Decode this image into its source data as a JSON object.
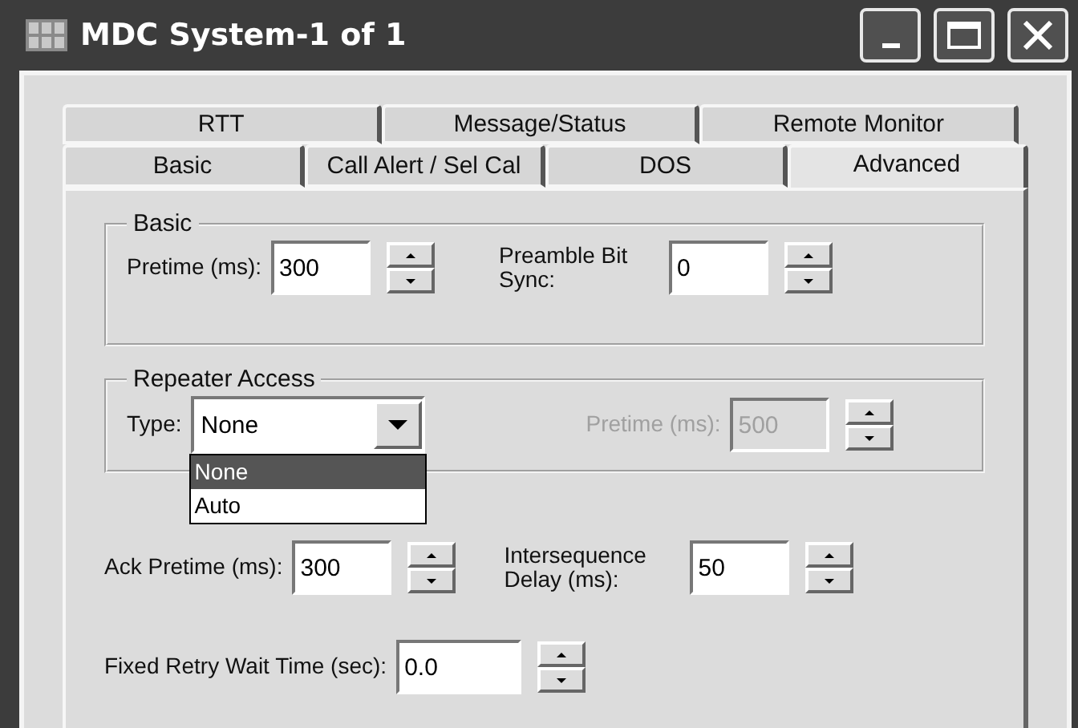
{
  "window": {
    "title": "MDC System-1 of 1"
  },
  "tab_rows": [
    [
      {
        "label": "RTT",
        "selected": false
      },
      {
        "label": "Message/Status",
        "selected": false
      },
      {
        "label": "Remote Monitor",
        "selected": false
      }
    ],
    [
      {
        "label": "Basic",
        "selected": false
      },
      {
        "label": "Call Alert / Sel Cal",
        "selected": false
      },
      {
        "label": "DOS",
        "selected": false
      },
      {
        "label": "Advanced",
        "selected": true
      }
    ]
  ],
  "basic_group": {
    "title": "Basic",
    "fields": [
      {
        "label": "Pretime (ms):",
        "value": "300",
        "disabled": false
      },
      {
        "label": "Preamble Bit Sync:",
        "value": "0",
        "disabled": false
      }
    ]
  },
  "repeater_group": {
    "title": "Repeater Access",
    "type_label": "Type:",
    "type_value": "None",
    "expanded": true,
    "options": [
      {
        "label": "None",
        "selected": true
      },
      {
        "label": "Auto",
        "selected": false
      }
    ],
    "pretime": {
      "label": "Pretime (ms):",
      "value": "500",
      "disabled": true
    }
  },
  "timing_fields": [
    {
      "label": "Ack Pretime (ms):",
      "value": "300",
      "disabled": false
    },
    {
      "label": "Intersequence Delay (ms):",
      "value": "50",
      "disabled": false
    }
  ],
  "retry_field": {
    "label": "Fixed Retry Wait Time (sec):",
    "value": "0.0",
    "disabled": false
  }
}
